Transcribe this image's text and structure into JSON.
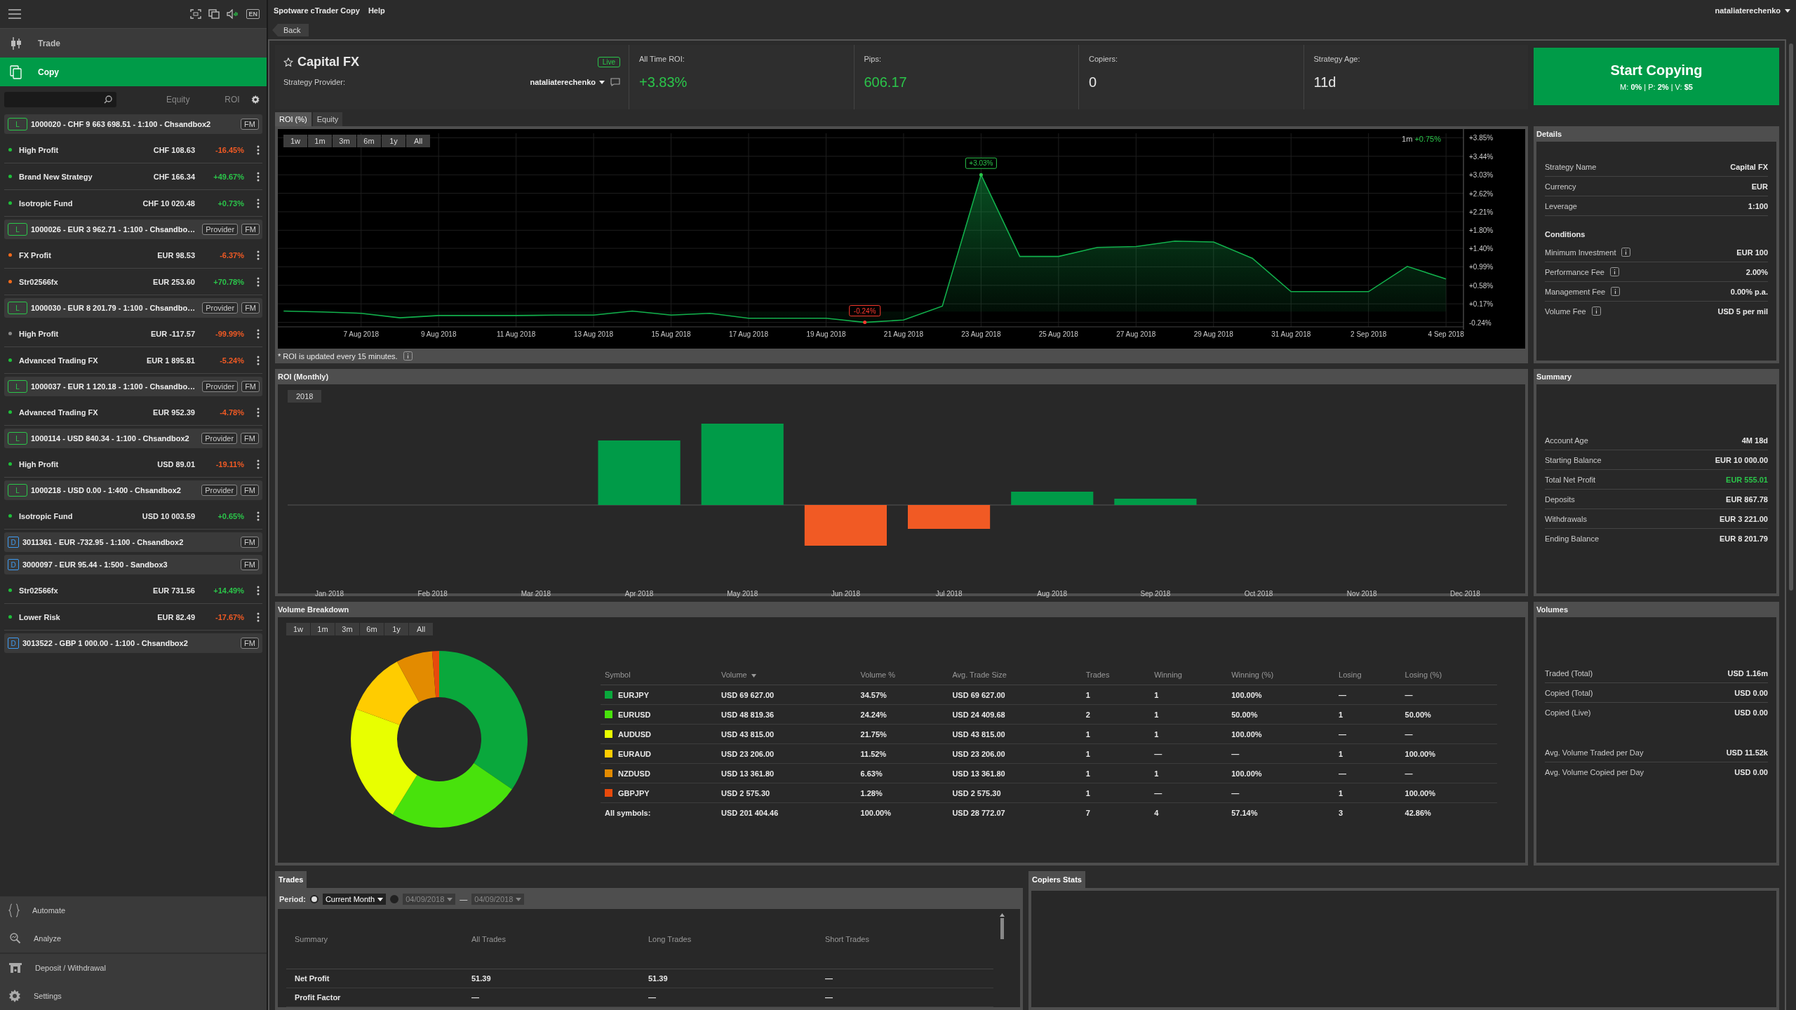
{
  "sidebar": {
    "language": "EN",
    "menu": [
      {
        "label": "Trade",
        "selected": false
      },
      {
        "label": "Copy",
        "selected": true
      }
    ],
    "columns": [
      "Equity",
      "ROI"
    ],
    "accounts": [
      {
        "kind": "live",
        "badge": "L",
        "label": "1000020 - CHF 9 663 698.51 - 1:100 - Chsandbox2",
        "buttons": [
          "FM"
        ],
        "strategies": [
          {
            "name": "High Profit",
            "equity": "CHF 108.63",
            "roi": "-16.45%",
            "kind": "loss",
            "color": "#1fbf3a"
          },
          {
            "name": "Brand New Strategy",
            "equity": "CHF 166.34",
            "roi": "+49.67%",
            "kind": "gain",
            "color": "#1fbf3a"
          },
          {
            "name": "Isotropic Fund",
            "equity": "CHF 10 020.48",
            "roi": "+0.73%",
            "kind": "gain",
            "color": "#1fbf3a"
          }
        ]
      },
      {
        "kind": "live",
        "badge": "L",
        "label": "1000026 - EUR 3 962.71 - 1:100 - Chsandbo…",
        "buttons": [
          "Provider",
          "FM"
        ],
        "strategies": [
          {
            "name": "FX Profit",
            "equity": "EUR 98.53",
            "roi": "-6.37%",
            "kind": "loss",
            "color": "#f26a1b"
          },
          {
            "name": "Str02566fx",
            "equity": "EUR 253.60",
            "roi": "+70.78%",
            "kind": "gain",
            "color": "#f26a1b"
          }
        ]
      },
      {
        "kind": "live",
        "badge": "L",
        "label": "1000030 - EUR 8 201.79 - 1:100 - Chsandbo…",
        "buttons": [
          "Provider",
          "FM"
        ],
        "strategies": [
          {
            "name": "High Profit",
            "equity": "EUR -117.57",
            "roi": "-99.99%",
            "kind": "loss",
            "color": "#8a8a8a"
          },
          {
            "name": "Advanced Trading FX",
            "equity": "EUR 1 895.81",
            "roi": "-5.24%",
            "kind": "loss",
            "color": "#1fbf3a"
          }
        ]
      },
      {
        "kind": "live",
        "badge": "L",
        "label": "1000037 - EUR 1 120.18 - 1:100 - Chsandbo…",
        "buttons": [
          "Provider",
          "FM"
        ],
        "strategies": [
          {
            "name": "Advanced Trading FX",
            "equity": "EUR 952.39",
            "roi": "-4.78%",
            "kind": "loss",
            "color": "#1fbf3a"
          }
        ]
      },
      {
        "kind": "live",
        "badge": "L",
        "label": "1000114 - USD 840.34 - 1:100 - Chsandbox2",
        "buttons": [
          "Provider",
          "FM"
        ],
        "strategies": [
          {
            "name": "High Profit",
            "equity": "USD 89.01",
            "roi": "-19.11%",
            "kind": "loss",
            "color": "#1fbf3a"
          }
        ]
      },
      {
        "kind": "live",
        "badge": "L",
        "label": "1000218 - USD 0.00 - 1:400 - Chsandbox2",
        "buttons": [
          "Provider",
          "FM"
        ],
        "strategies": [
          {
            "name": "Isotropic Fund",
            "equity": "USD 10 003.59",
            "roi": "+0.65%",
            "kind": "gain",
            "color": "#1fbf3a"
          }
        ]
      },
      {
        "kind": "demo",
        "badge": "D",
        "label": "3011361 - EUR -732.95 - 1:100 - Chsandbox2",
        "buttons": [
          "FM"
        ]
      },
      {
        "kind": "demo",
        "badge": "D",
        "label": "3000097 - EUR 95.44 - 1:500 - Sandbox3",
        "buttons": [
          "FM"
        ],
        "strategies": [
          {
            "name": "Str02566fx",
            "equity": "EUR 731.56",
            "roi": "+14.49%",
            "kind": "gain",
            "color": "#1fbf3a"
          },
          {
            "name": "Lower Risk",
            "equity": "EUR 82.49",
            "roi": "-17.67%",
            "kind": "loss",
            "color": "#1fbf3a"
          }
        ]
      },
      {
        "kind": "demo",
        "badge": "D",
        "label": "3013522 - GBP 1 000.00 - 1:100 - Chsandbox2",
        "buttons": [
          "FM"
        ]
      }
    ],
    "bottom_menu": [
      {
        "label": "Automate"
      },
      {
        "label": "Analyze"
      },
      {
        "label": "Deposit / Withdrawal"
      },
      {
        "label": "Settings"
      }
    ]
  },
  "top_bar": {
    "title": "Spotware cTrader Copy",
    "menu": [
      "Help"
    ],
    "user": "nataliaterechenko"
  },
  "back_button": "Back",
  "strategy": {
    "name": "Capital FX",
    "status": "Live",
    "provider_label": "Strategy Provider:",
    "provider": "nataliaterechenko",
    "stats": [
      {
        "label": "All Time ROI:",
        "value": "+3.83%",
        "kind": "positive"
      },
      {
        "label": "Pips:",
        "value": "606.17",
        "kind": "positive"
      },
      {
        "label": "Copiers:",
        "value": "0",
        "kind": "plain"
      },
      {
        "label": "Strategy Age:",
        "value": "11d",
        "kind": "plain"
      }
    ]
  },
  "start_copying": {
    "label": "Start Copying",
    "terms": "M: **0%** | P: **2%** | V: **$5**"
  },
  "chart_tabs": [
    {
      "label": "ROI (%)",
      "selected": true
    },
    {
      "label": "Equity",
      "selected": false
    }
  ],
  "roi_chart": {
    "ranges": [
      {
        "label": "1w",
        "selected": false
      },
      {
        "label": "1m",
        "selected": false
      },
      {
        "label": "3m",
        "selected": false
      },
      {
        "label": "6m",
        "selected": false
      },
      {
        "label": "1y",
        "selected": false
      },
      {
        "label": "All",
        "selected": false
      }
    ],
    "legend_period": "1m",
    "legend_value": "+0.75%",
    "note": "* ROI is updated every 15 minutes.",
    "chart_data": {
      "type": "area",
      "grid": true,
      "categories": [
        null,
        null,
        "7 Aug 2018",
        null,
        "9 Aug 2018",
        null,
        "11 Aug 2018",
        null,
        "13 Aug 2018",
        null,
        "15 Aug 2018",
        null,
        "17 Aug 2018",
        null,
        "19 Aug 2018",
        null,
        "21 Aug 2018",
        null,
        "23 Aug 2018",
        null,
        "25 Aug 2018",
        null,
        "27 Aug 2018",
        null,
        "29 Aug 2018",
        null,
        "31 Aug 2018",
        null,
        "2 Sep 2018",
        null,
        "4 Sep 2018"
      ],
      "series": [
        {
          "color": "#12b04c",
          "values": [
            0.01,
            -0.01,
            -0.04,
            -0.14,
            -0.09,
            -0.09,
            -0.09,
            -0.08,
            -0.08,
            0.01,
            -0.08,
            -0.04,
            -0.15,
            -0.15,
            -0.15,
            -0.24,
            -0.19,
            0.12,
            3.03,
            1.22,
            1.22,
            1.42,
            1.44,
            1.56,
            1.54,
            1.18,
            0.44,
            0.44,
            0.44,
            1.0,
            0.72
          ]
        }
      ],
      "ylim": [
        -0.34,
        3.95
      ],
      "yticks": [
        {
          "value": 3.85,
          "label": "+3.85%"
        },
        {
          "value": 3.44,
          "label": "+3.44%"
        },
        {
          "value": 3.03,
          "label": "+3.03%"
        },
        {
          "value": 2.62,
          "label": "+2.62%"
        },
        {
          "value": 2.21,
          "label": "+2.21%"
        },
        {
          "value": 1.8,
          "label": "+1.80%"
        },
        {
          "value": 1.4,
          "label": "+1.40%"
        },
        {
          "value": 0.99,
          "label": "+0.99%"
        },
        {
          "value": 0.58,
          "label": "+0.58%"
        },
        {
          "value": 0.17,
          "label": "+0.17%"
        },
        {
          "value": -0.24,
          "label": "-0.24%"
        }
      ],
      "annotations": [
        {
          "x": "23 Aug 2018",
          "y": 3.03,
          "text": "+3.03%"
        },
        {
          "y": -0.24,
          "text": "-0.24%"
        }
      ]
    }
  },
  "details": {
    "title": "Details",
    "rows": [
      {
        "label": "Strategy Name",
        "value": "Capital FX"
      },
      {
        "label": "Currency",
        "value": "EUR"
      },
      {
        "label": "Leverage",
        "value": "1:100"
      }
    ],
    "conditions_title": "Conditions",
    "conditions": [
      {
        "label": "Minimum Investment",
        "value": "EUR 100"
      },
      {
        "label": "Performance Fee",
        "value": "2.00%"
      },
      {
        "label": "Management Fee",
        "value": "0.00% p.a."
      },
      {
        "label": "Volume Fee",
        "value": "USD 5 per mil"
      }
    ]
  },
  "monthly": {
    "title": "ROI (Monthly)",
    "year": "2018",
    "months": [
      "Jan 2018",
      "Feb 2018",
      "Mar 2018",
      "Apr 2018",
      "May 2018",
      "Jun 2018",
      "Jul 2018",
      "Aug 2018",
      "Sep 2018",
      "Oct 2018",
      "Nov 2018",
      "Dec 2018"
    ]
  },
  "summary": {
    "title": "Summary",
    "rows": [
      {
        "label": "Account Age",
        "value": "4M 18d",
        "kind": "plain"
      },
      {
        "label": "Starting Balance",
        "value": "EUR 10 000.00",
        "kind": "plain"
      },
      {
        "label": "Total Net Profit",
        "value": "EUR 555.01",
        "kind": "positive"
      },
      {
        "label": "Deposits",
        "value": "EUR 867.78",
        "kind": "plain"
      },
      {
        "label": "Withdrawals",
        "value": "EUR 3 221.00",
        "kind": "plain"
      },
      {
        "label": "Ending Balance",
        "value": "EUR 8 201.79",
        "kind": "plain"
      }
    ]
  },
  "volume": {
    "title": "Volume Breakdown",
    "ranges": [
      {
        "label": "1w",
        "selected": false
      },
      {
        "label": "1m",
        "selected": false
      },
      {
        "label": "3m",
        "selected": false
      },
      {
        "label": "6m",
        "selected": false
      },
      {
        "label": "1y",
        "selected": false
      },
      {
        "label": "All",
        "selected": false
      }
    ],
    "chart_data": {
      "type": "donut",
      "values": [
        34.57,
        24.24,
        21.75,
        11.52,
        6.63,
        1.28
      ]
    },
    "columns": [
      {
        "label": "Symbol",
        "sorted": false
      },
      {
        "label": "Volume",
        "sorted": true
      },
      {
        "label": "Volume %",
        "sorted": false
      },
      {
        "label": "Avg. Trade Size",
        "sorted": false
      },
      {
        "label": "Trades",
        "sorted": false
      },
      {
        "label": "Winning",
        "sorted": false
      },
      {
        "label": "Winning (%)",
        "sorted": false
      },
      {
        "label": "Losing",
        "sorted": false
      },
      {
        "label": "Losing (%)",
        "sorted": false
      }
    ],
    "rows": [
      {
        "color": "#0aa83c",
        "cells": [
          "EURJPY",
          "USD 69 627.00",
          "34.57%",
          "USD 69 627.00",
          "1",
          "1",
          "100.00%",
          "—",
          "—"
        ]
      },
      {
        "color": "#48e20c",
        "cells": [
          "EURUSD",
          "USD 48 819.36",
          "24.24%",
          "USD 24 409.68",
          "2",
          "1",
          "50.00%",
          "1",
          "50.00%"
        ]
      },
      {
        "color": "#e8ff00",
        "cells": [
          "AUDUSD",
          "USD 43 815.00",
          "21.75%",
          "USD 43 815.00",
          "1",
          "1",
          "100.00%",
          "—",
          "—"
        ]
      },
      {
        "color": "#ffcc00",
        "cells": [
          "EURAUD",
          "USD 23 206.00",
          "11.52%",
          "USD 23 206.00",
          "1",
          "—",
          "—",
          "1",
          "100.00%"
        ]
      },
      {
        "color": "#e38b00",
        "cells": [
          "NZDUSD",
          "USD 13 361.80",
          "6.63%",
          "USD 13 361.80",
          "1",
          "1",
          "100.00%",
          "—",
          "—"
        ]
      },
      {
        "color": "#e84a0c",
        "cells": [
          "GBPJPY",
          "USD 2 575.30",
          "1.28%",
          "USD 2 575.30",
          "1",
          "—",
          "—",
          "1",
          "100.00%"
        ]
      }
    ],
    "total": [
      "All symbols:",
      "USD 201 404.46",
      "100.00%",
      "USD 28 772.07",
      "7",
      "4",
      "57.14%",
      "3",
      "42.86%"
    ]
  },
  "volumes": {
    "title": "Volumes",
    "groups": [
      [
        {
          "label": "Traded (Total)",
          "value": "USD 1.16m"
        },
        {
          "label": "Copied (Total)",
          "value": "USD 0.00"
        },
        {
          "label": "Copied (Live)",
          "value": "USD 0.00"
        }
      ],
      [
        {
          "label": "Avg. Volume Traded per Day",
          "value": "USD 11.52k"
        },
        {
          "label": "Avg. Volume Copied per Day",
          "value": "USD 0.00"
        }
      ]
    ]
  },
  "trades": {
    "tab": "Trades",
    "period_label": "Period:",
    "options": [
      {
        "label": "Current Month",
        "selected": true
      },
      {
        "from": "04/09/2018",
        "to": "04/09/2018",
        "separator": "—",
        "selected": false
      }
    ],
    "columns": [
      "Summary",
      "All Trades",
      "Long Trades",
      "Short Trades"
    ],
    "rows": [
      [
        "Net Profit",
        "51.39",
        "51.39",
        "—"
      ],
      [
        "Profit Factor",
        "—",
        "—",
        "—"
      ]
    ]
  },
  "copiers": {
    "tab": "Copiers Stats"
  }
}
